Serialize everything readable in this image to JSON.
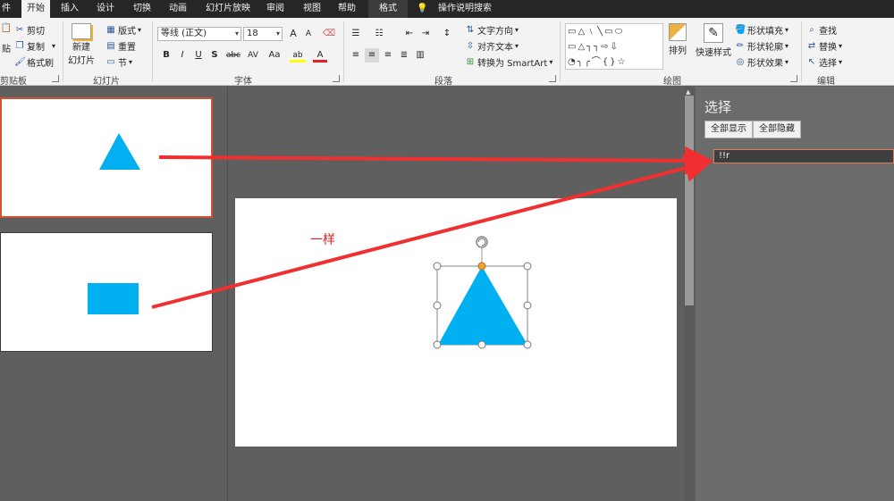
{
  "tabs": [
    "件",
    "开始",
    "插入",
    "设计",
    "切换",
    "动画",
    "幻灯片放映",
    "审阅",
    "视图",
    "帮助",
    "格式",
    "操作说明搜索"
  ],
  "ribbon": {
    "clipboard": {
      "paste_partial": "贴",
      "cut": "剪切",
      "copy": "复制",
      "format_painter": "格式刷",
      "label": "剪贴板"
    },
    "slides": {
      "new_slide_1": "新建",
      "new_slide_2": "幻灯片",
      "layout": "版式",
      "reset": "重置",
      "section": "节",
      "label": "幻灯片"
    },
    "font": {
      "font_name": "等线 (正文)",
      "font_size": "18",
      "grow": "A",
      "shrink": "A",
      "bold": "B",
      "italic": "I",
      "underline": "U",
      "shadow": "S",
      "strike": "abc",
      "spacing": "AV",
      "case": "Aa",
      "highlight": "ab",
      "color": "A",
      "label": "字体"
    },
    "paragraph": {
      "text_direction": "文字方向",
      "align_text": "对齐文本",
      "smartart": "转换为 SmartArt",
      "label": "段落"
    },
    "drawing": {
      "arrange": "排列",
      "quick_styles": "快速样式",
      "shape_fill": "形状填充",
      "shape_outline": "形状轮廓",
      "shape_effects": "形状效果",
      "label": "绘图"
    },
    "editing": {
      "find": "查找",
      "replace": "替换",
      "select": "选择",
      "label": "编辑"
    }
  },
  "selection_pane": {
    "title": "选择",
    "show_all": "全部显示",
    "hide_all": "全部隐藏",
    "item": "!!r"
  },
  "slide": {
    "annotation": "一样"
  },
  "colors": {
    "accent": "#d35230",
    "shape": "#00b0f0",
    "arrow": "#f03030",
    "tabbar": "#262626",
    "ribbon": "#f3f3f3"
  }
}
